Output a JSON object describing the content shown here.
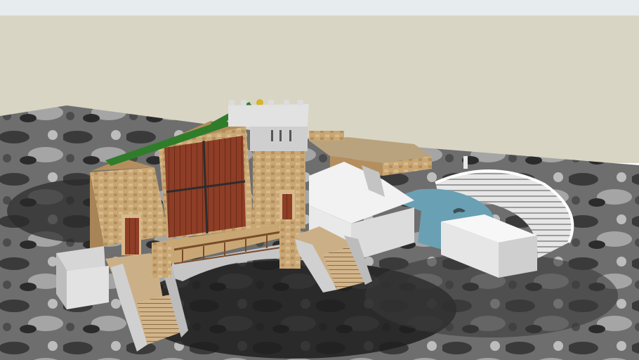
{
  "viewport": {
    "sky_color": "#d8d5c4",
    "top_strip_color": "#e7ecee",
    "ground_light": "#9a9a9a",
    "ground_dark": "#2a2a2a"
  },
  "model": {
    "components": [
      "theatre-stage-building",
      "watch-tower",
      "green-canopy-roof",
      "red-wooden-doors",
      "arched-bridge-walkway",
      "left-staircase",
      "right-staircase",
      "white-box-platform",
      "pool-water",
      "amphitheatre-seating",
      "fort-wall"
    ],
    "colors": {
      "sandstone": "#c9a774",
      "sandstone_dark": "#a88456",
      "stone_gray": "#cfcfcf",
      "wood_red": "#8e3d26",
      "canopy_green": "#2f7d2a",
      "water_blue": "#6aa0b4",
      "white_box": "#f0f0f0",
      "railing_brown": "#7a4a2a"
    }
  }
}
